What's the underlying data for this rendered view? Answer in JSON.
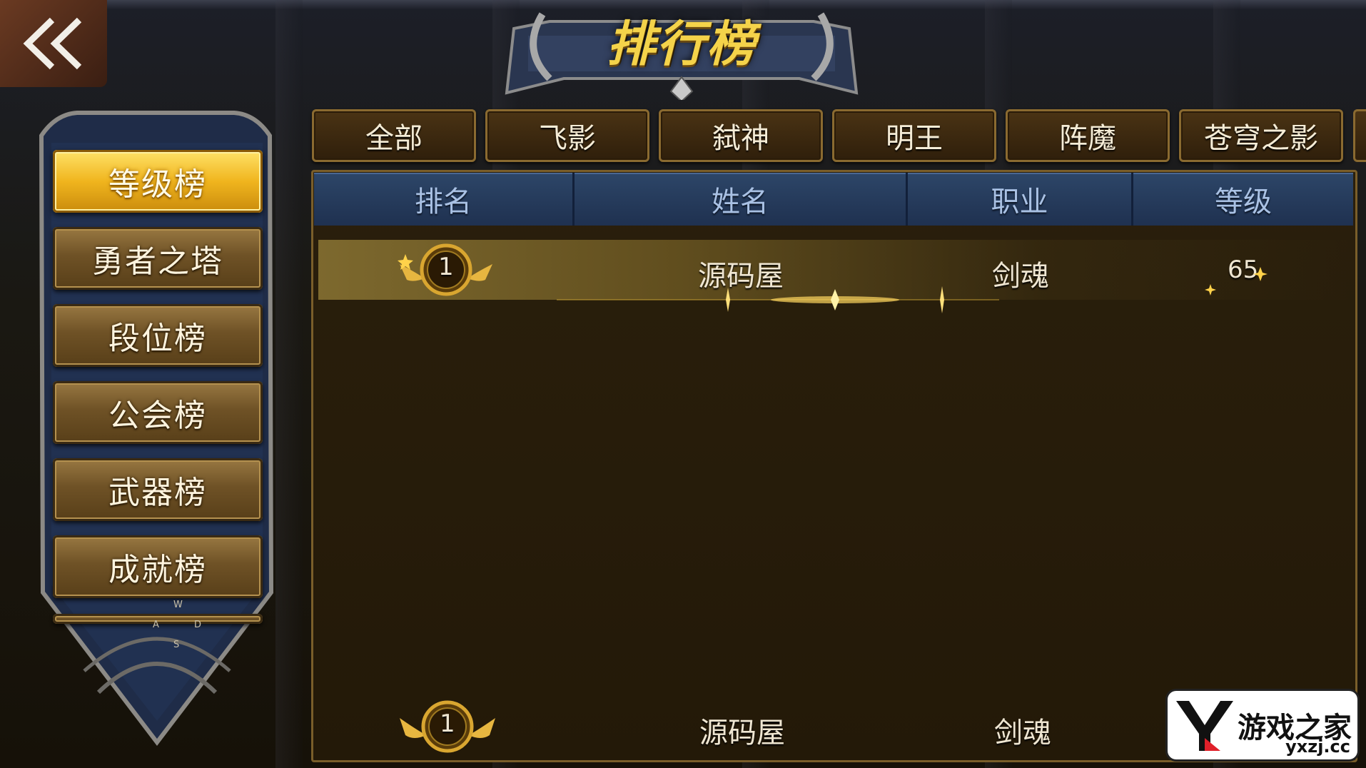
{
  "header": {
    "title": "排行榜",
    "back_icon": "double-chevron-left-icon"
  },
  "sidebar": {
    "items": [
      {
        "label": "等级榜",
        "active": true
      },
      {
        "label": "勇者之塔",
        "active": false
      },
      {
        "label": "段位榜",
        "active": false
      },
      {
        "label": "公会榜",
        "active": false
      },
      {
        "label": "武器榜",
        "active": false
      },
      {
        "label": "成就榜",
        "active": false
      }
    ],
    "keys": {
      "w": "W",
      "a": "A",
      "s": "S",
      "d": "D"
    }
  },
  "tabs": [
    {
      "label": "全部"
    },
    {
      "label": "飞影"
    },
    {
      "label": "弑神"
    },
    {
      "label": "明王"
    },
    {
      "label": "阵魔"
    },
    {
      "label": "苍穹之影"
    }
  ],
  "table": {
    "headers": [
      "排名",
      "姓名",
      "职业",
      "等级"
    ],
    "rows": [
      {
        "rank": "1",
        "name": "源码屋",
        "class": "剑魂",
        "level": "65"
      }
    ],
    "self_row": {
      "rank": "1",
      "name": "源码屋",
      "class": "剑魂"
    }
  },
  "watermark": {
    "brand": "游戏之家",
    "url": "yxzj.cc"
  },
  "colors": {
    "gold": "#f0b51e",
    "header_blue": "#2d4668",
    "tab_border": "#8a6a30"
  }
}
